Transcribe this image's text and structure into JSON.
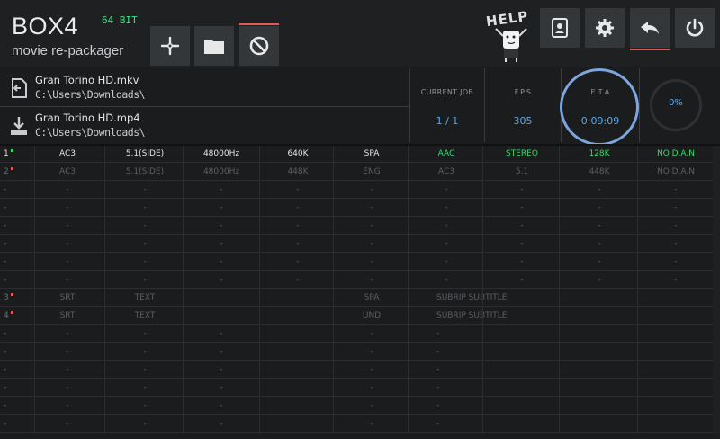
{
  "app": {
    "logo": "BOX4",
    "bit": "64 BIT",
    "subtitle": "movie re-packager",
    "help_text": "HELP"
  },
  "toolbar": {
    "left": [
      {
        "name": "add-button",
        "icon": "plus-icon"
      },
      {
        "name": "open-folder-button",
        "icon": "folder-icon"
      },
      {
        "name": "cancel-button",
        "icon": "prohibited-icon"
      }
    ],
    "right": [
      {
        "name": "contacts-button",
        "icon": "address-book-icon"
      },
      {
        "name": "settings-button",
        "icon": "gear-icon"
      },
      {
        "name": "undo-button",
        "icon": "undo-icon"
      },
      {
        "name": "power-button",
        "icon": "power-icon"
      }
    ]
  },
  "files": {
    "source": {
      "name": "Gran Torino HD.mkv",
      "path": "C:\\Users\\Downloads\\"
    },
    "target": {
      "name": "Gran Torino HD.mp4",
      "path": "C:\\Users\\Downloads\\"
    }
  },
  "stats": {
    "current_job": {
      "label": "CURRENT JOB",
      "value": "1 / 1"
    },
    "fps": {
      "label": "F.P.S",
      "value": "305"
    },
    "eta": {
      "label": "E.T.A",
      "value": "0:09:09"
    },
    "progress": "0%"
  },
  "tracks": [
    {
      "idx": "1",
      "dot": "#39d96f",
      "active": true,
      "cells": [
        "AC3",
        "5.1(SIDE)",
        "48000Hz",
        "640K",
        "SPA",
        "AAC",
        "STEREO",
        "128K",
        "NO D.A.N"
      ]
    },
    {
      "idx": "2",
      "dot": "#e05a5a",
      "active": false,
      "cells": [
        "AC3",
        "5.1(SIDE)",
        "48000Hz",
        "448K",
        "ENG",
        "AC3",
        "5.1",
        "448K",
        "NO D.A.N"
      ]
    },
    {
      "idx": "-",
      "dot": "",
      "active": false,
      "cells": [
        "-",
        "-",
        "-",
        "-",
        "-",
        "-",
        "-",
        "-",
        "-"
      ]
    },
    {
      "idx": "-",
      "dot": "",
      "active": false,
      "cells": [
        "-",
        "-",
        "-",
        "-",
        "-",
        "-",
        "-",
        "-",
        "-"
      ]
    },
    {
      "idx": "-",
      "dot": "",
      "active": false,
      "cells": [
        "-",
        "-",
        "-",
        "-",
        "-",
        "-",
        "-",
        "-",
        "-"
      ]
    },
    {
      "idx": "-",
      "dot": "",
      "active": false,
      "cells": [
        "-",
        "-",
        "-",
        "-",
        "-",
        "-",
        "-",
        "-",
        "-"
      ]
    },
    {
      "idx": "-",
      "dot": "",
      "active": false,
      "cells": [
        "-",
        "-",
        "-",
        "-",
        "-",
        "-",
        "-",
        "-",
        "-"
      ]
    },
    {
      "idx": "-",
      "dot": "",
      "active": false,
      "cells": [
        "-",
        "-",
        "-",
        "-",
        "-",
        "-",
        "-",
        "-",
        "-"
      ]
    },
    {
      "idx": "3",
      "dot": "#e05a5a",
      "active": false,
      "sub": true,
      "cells": [
        "SRT",
        "TEXT",
        "",
        "",
        "SPA",
        "SUBRIP SUBTITLE",
        "",
        "",
        ""
      ]
    },
    {
      "idx": "4",
      "dot": "#e05a5a",
      "active": false,
      "sub": true,
      "cells": [
        "SRT",
        "TEXT",
        "",
        "",
        "UND",
        "SUBRIP SUBTITLE",
        "",
        "",
        ""
      ]
    },
    {
      "idx": "-",
      "dot": "",
      "active": false,
      "sub": true,
      "cells": [
        "-",
        "-",
        "-",
        "",
        "-",
        "-",
        "",
        "",
        ""
      ]
    },
    {
      "idx": "-",
      "dot": "",
      "active": false,
      "sub": true,
      "cells": [
        "-",
        "-",
        "-",
        "",
        "-",
        "-",
        "",
        "",
        ""
      ]
    },
    {
      "idx": "-",
      "dot": "",
      "active": false,
      "sub": true,
      "cells": [
        "-",
        "-",
        "-",
        "",
        "-",
        "-",
        "",
        "",
        ""
      ]
    },
    {
      "idx": "-",
      "dot": "",
      "active": false,
      "sub": true,
      "cells": [
        "-",
        "-",
        "-",
        "",
        "-",
        "-",
        "",
        "",
        ""
      ]
    },
    {
      "idx": "-",
      "dot": "",
      "active": false,
      "sub": true,
      "cells": [
        "-",
        "-",
        "-",
        "",
        "-",
        "-",
        "",
        "",
        ""
      ]
    },
    {
      "idx": "-",
      "dot": "",
      "active": false,
      "sub": true,
      "cells": [
        "-",
        "-",
        "-",
        "",
        "-",
        "-",
        "",
        "",
        ""
      ]
    }
  ],
  "colors": {
    "accent_blue": "#5aa7e8",
    "active_green": "#39d96f",
    "marker_red": "#e05a5a"
  }
}
